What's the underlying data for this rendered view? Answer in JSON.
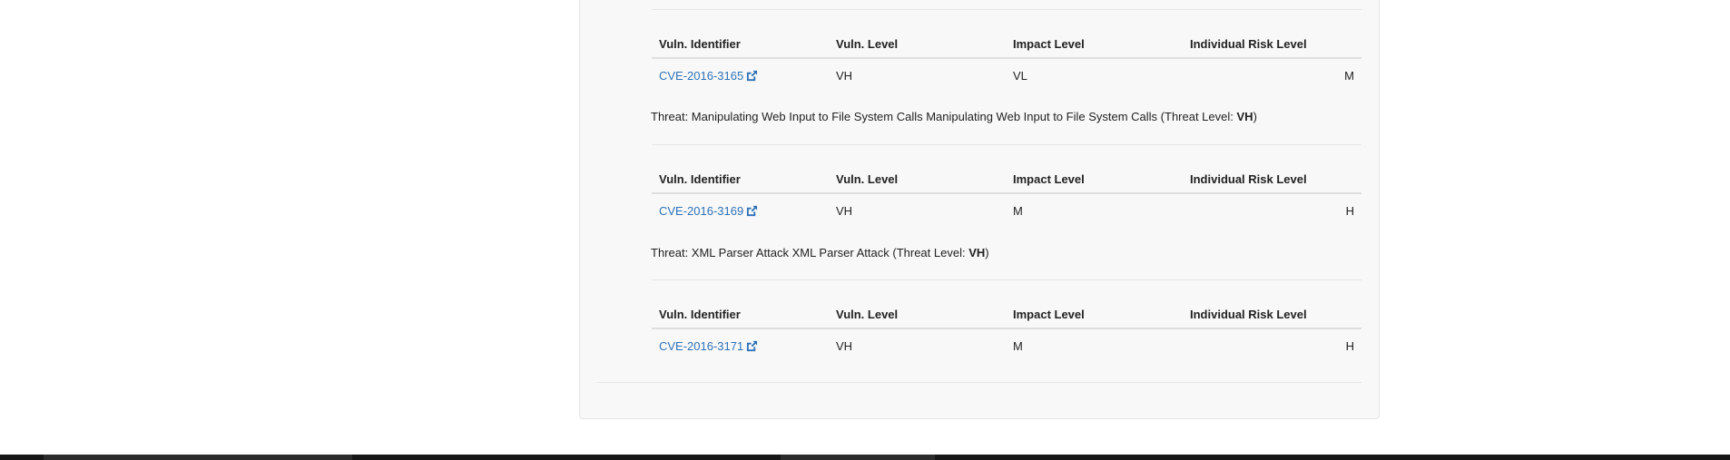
{
  "columns": [
    "Vuln. Identifier",
    "Vuln. Level",
    "Impact Level",
    "Individual Risk Level"
  ],
  "threat_prefix": "Threat: ",
  "threat_level_prefix": " (Threat Level: ",
  "threat_level_suffix": ")",
  "sections": [
    {
      "threat": null,
      "rows": [
        {
          "id": "CVE-2016-3165",
          "vuln_level": "VH",
          "impact_level": "VL",
          "risk_level": "M"
        }
      ]
    },
    {
      "threat": {
        "name": "Manipulating Web Input to File System Calls Manipulating Web Input to File System Calls",
        "level": "VH"
      },
      "rows": [
        {
          "id": "CVE-2016-3169",
          "vuln_level": "VH",
          "impact_level": "M",
          "risk_level": "H"
        }
      ]
    },
    {
      "threat": {
        "name": "XML Parser Attack XML Parser Attack",
        "level": "VH"
      },
      "rows": [
        {
          "id": "CVE-2016-3171",
          "vuln_level": "VH",
          "impact_level": "M",
          "risk_level": "H"
        }
      ]
    }
  ]
}
